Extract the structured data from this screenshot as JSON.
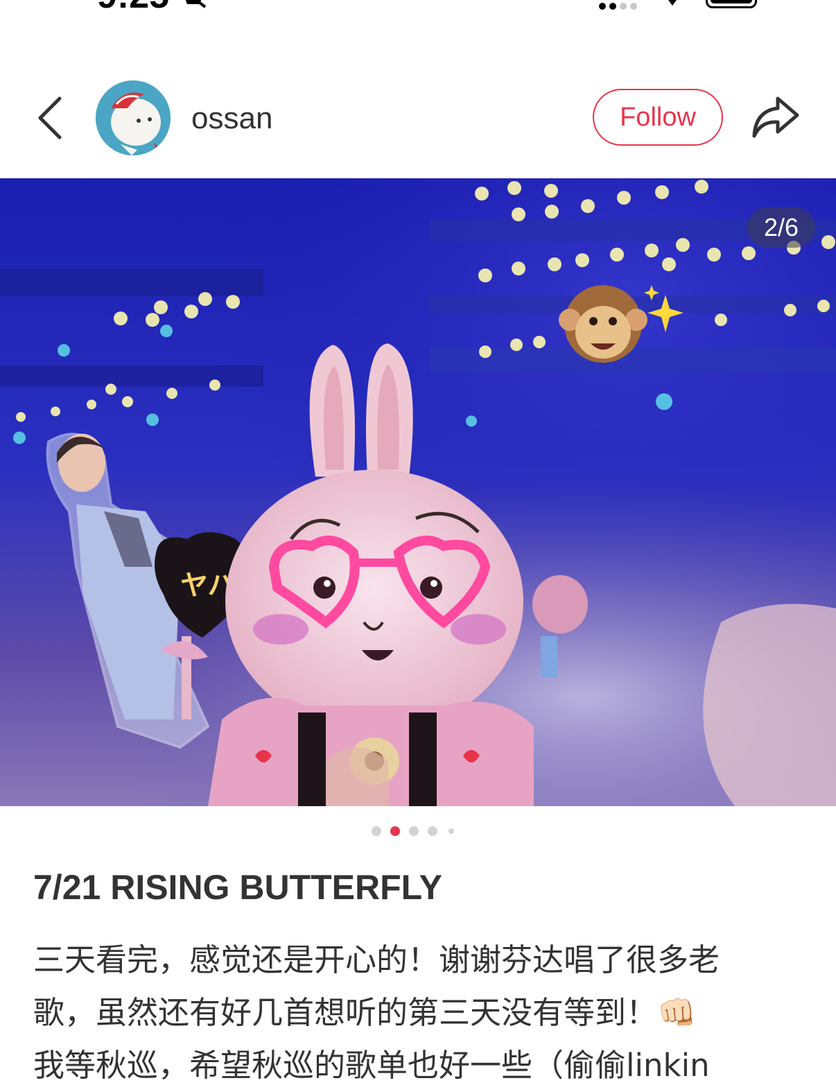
{
  "status_bar": {
    "time": "9:25"
  },
  "header": {
    "username": "ossan",
    "follow_label": "Follow"
  },
  "photo": {
    "counter": "2/6",
    "dots_total": 5,
    "active_dot": 2,
    "emoji": "🐵✨"
  },
  "post": {
    "title": "7/21 RISING BUTTERFLY",
    "lines": [
      "三天看完，感觉还是开心的！谢谢芬达唱了很多老",
      "歌，虽然还有好几首想听的第三天没有等到！👊🏻",
      "我等秋巡，希望秋巡的歌单也好一些（偷偷linkin"
    ]
  },
  "colors": {
    "accent": "#e8344b"
  },
  "icons": [
    "back-arrow-icon",
    "share-icon",
    "mute-bell-icon",
    "wifi-icon",
    "battery-icon"
  ]
}
